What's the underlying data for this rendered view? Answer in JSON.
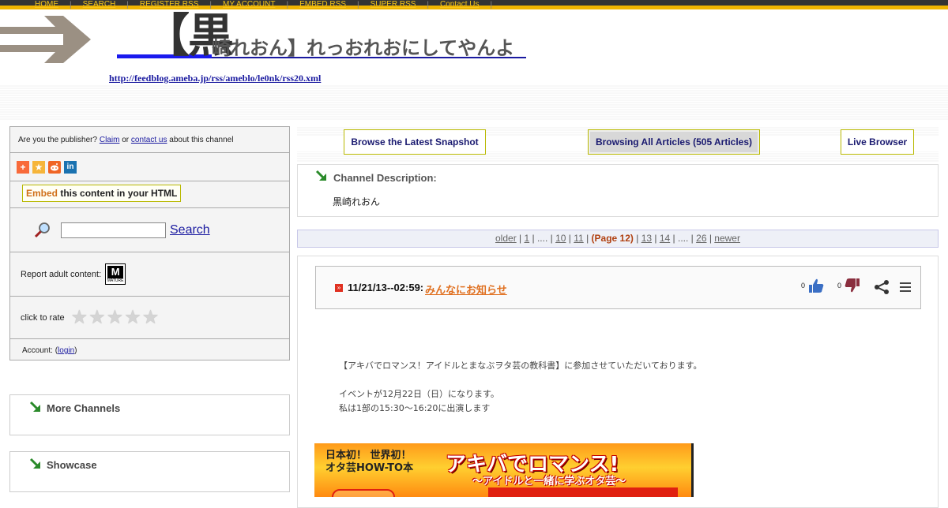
{
  "nav": {
    "items": [
      "HOME",
      "SEARCH",
      "REGISTER RSS",
      "MY ACCOUNT",
      "EMBED RSS",
      "SUPER RSS",
      "Contact Us"
    ]
  },
  "header": {
    "title_big": "【黒",
    "title_rest": "崎れおん】れっおれおにしてやんよ",
    "feed_url": "http://feedblog.ameba.jp/rss/ameblo/le0nk/rss20.xml"
  },
  "sidebar": {
    "claim_prefix": "Are you the publisher?",
    "claim_link": "Claim",
    "claim_or": "or",
    "contact_link": "contact us",
    "claim_suffix": "about this channel",
    "embed_word": "Embed",
    "embed_rest": "this content in your HTML",
    "search_label": "Search",
    "report_label": "Report adult content:",
    "mature_badge": "M",
    "mature_sub": "MATURE",
    "rate_label": "click to rate",
    "account_prefix": "Account: (",
    "account_link": "login",
    "account_suffix": ")",
    "more_channels": "More Channels",
    "showcase": "Showcase"
  },
  "tabs": {
    "latest": "Browse the Latest Snapshot",
    "all": "Browsing All Articles (505 Articles)",
    "live": "Live Browser"
  },
  "description": {
    "title": "Channel Description:",
    "text": "黒崎れおん"
  },
  "pager": {
    "older": "older",
    "p1": "1",
    "dots1": "....",
    "p10": "10",
    "p11": "11",
    "current": "(Page 12)",
    "p13": "13",
    "p14": "14",
    "dots2": "....",
    "p26": "26",
    "newer": "newer"
  },
  "article": {
    "date": "11/21/13--02:59:",
    "title": "みんなにお知らせ",
    "likes": "0",
    "dislikes": "0",
    "body_line1": "【アキバでロマンス！アイドルとまなぶヲタ芸の教科書】に参加させていただいております。",
    "body_line2": "イベントが12月22日（日）になります。",
    "body_line3": "私は1部の15:30～16:20に出演します"
  },
  "banner": {
    "line1": "日本初！ 世界初！",
    "line2": "オタ芸HOW-TO本",
    "headline": "アキバでロマンス!",
    "subline": "～アイドルと一緒に学ぶオタ芸～"
  },
  "colors": {
    "nav_bg": "#333333",
    "nav_link": "#f5c518",
    "accent_yellow": "#f0b400",
    "link_blue": "#1a1aa0",
    "article_link": "#e07020",
    "current_page": "#b04010"
  }
}
